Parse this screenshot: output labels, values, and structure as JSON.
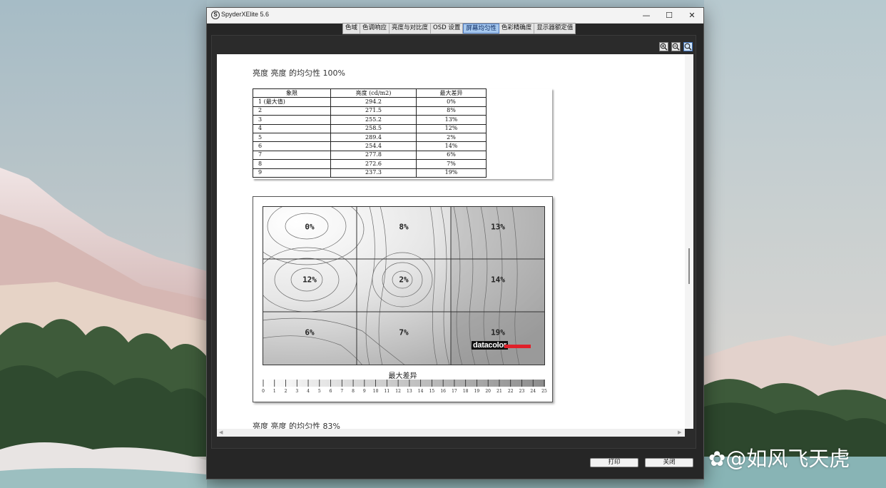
{
  "window": {
    "title": "SpyderXElite 5.6",
    "app_icon_glyph": "S",
    "minimize_glyph": "—",
    "maximize_glyph": "☐",
    "close_glyph": "✕"
  },
  "tabs": [
    {
      "label": "色域"
    },
    {
      "label": "色调响应"
    },
    {
      "label": "亮度与对比度"
    },
    {
      "label": "OSD 设置"
    },
    {
      "label": "屏幕均匀性",
      "active": true
    },
    {
      "label": "色彩精确度"
    },
    {
      "label": "显示器额定值"
    }
  ],
  "zoom_buttons": [
    "zoom-in-icon",
    "zoom-out-icon",
    "zoom-fit-icon"
  ],
  "report": {
    "section1_title": "亮度 亮度 的均匀性 100%",
    "section2_title": "亮度 亮度 的均匀性 83%",
    "table": {
      "headers": [
        "象限",
        "亮度 (cd/m2)",
        "最大差异"
      ],
      "rows": [
        [
          "1 (最大值)",
          "294.2",
          "0%"
        ],
        [
          "2",
          "271.5",
          "8%"
        ],
        [
          "3",
          "255.2",
          "13%"
        ],
        [
          "4",
          "258.5",
          "12%"
        ],
        [
          "5",
          "289.4",
          "2%"
        ],
        [
          "6",
          "254.4",
          "14%"
        ],
        [
          "7",
          "277.8",
          "6%"
        ],
        [
          "8",
          "272.6",
          "7%"
        ],
        [
          "9",
          "237.3",
          "19%"
        ]
      ]
    },
    "map": {
      "cell_labels": [
        "0%",
        "8%",
        "13%",
        "12%",
        "2%",
        "14%",
        "6%",
        "7%",
        "19%"
      ],
      "scale_title": "最大差异",
      "scale_ticks": [
        "0",
        "1",
        "2",
        "3",
        "4",
        "5",
        "6",
        "7",
        "8",
        "9",
        "10",
        "11",
        "12",
        "13",
        "14",
        "15",
        "16",
        "17",
        "18",
        "19",
        "20",
        "21",
        "22",
        "23",
        "24",
        "25"
      ],
      "brand": "datacolor",
      "brand_color": "#e0202a"
    }
  },
  "footer": {
    "print_label": "打印",
    "close_label": "关闭"
  },
  "watermark": "@如风飞天虎",
  "watermark_icon": "du"
}
